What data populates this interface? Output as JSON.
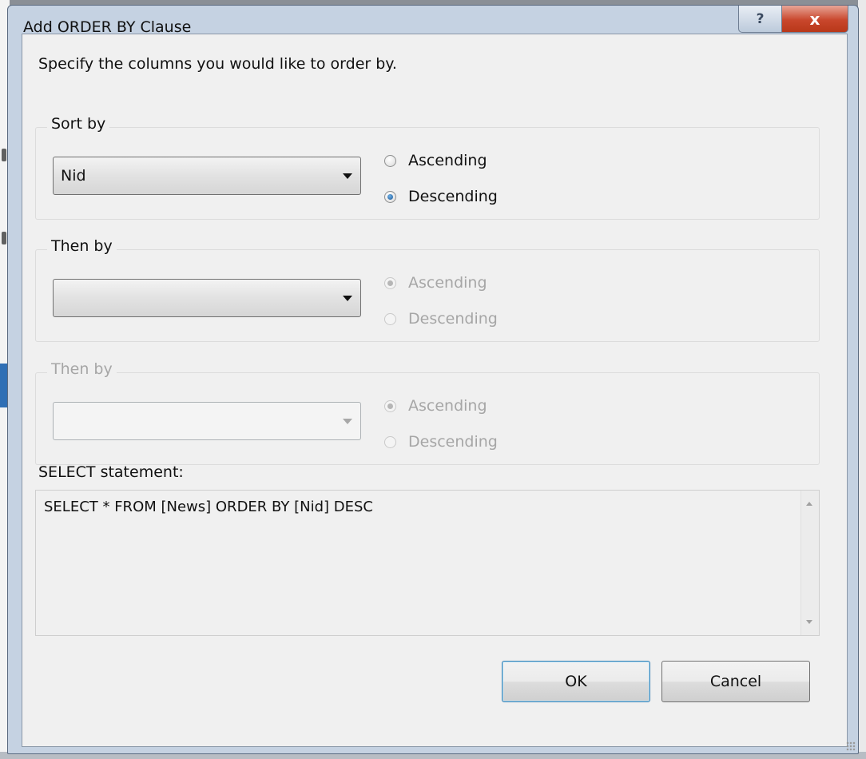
{
  "window": {
    "title": "Add ORDER BY Clause",
    "help_glyph": "?",
    "close_glyph": "x"
  },
  "instructions": "Specify the columns you would like to order by.",
  "sort_groups": [
    {
      "label": "Sort by",
      "enabled": true,
      "column": "Nid",
      "ascending_label": "Ascending",
      "descending_label": "Descending",
      "direction": "descending"
    },
    {
      "label": "Then by",
      "enabled": true,
      "column": "",
      "ascending_label": "Ascending",
      "descending_label": "Descending",
      "direction": "ascending",
      "radios_enabled": false
    },
    {
      "label": "Then by",
      "enabled": false,
      "column": "",
      "ascending_label": "Ascending",
      "descending_label": "Descending",
      "direction": "ascending"
    }
  ],
  "select_statement": {
    "label": "SELECT statement:",
    "text": "SELECT * FROM [News] ORDER BY [Nid] DESC"
  },
  "buttons": {
    "ok": "OK",
    "cancel": "Cancel"
  },
  "colors": {
    "title_bar": "#c5d2e2",
    "close_button": "#c9472c",
    "dialog_body": "#f0f0f0",
    "disabled_text": "#a6a6a6",
    "radio_selected": "#1c5896"
  }
}
